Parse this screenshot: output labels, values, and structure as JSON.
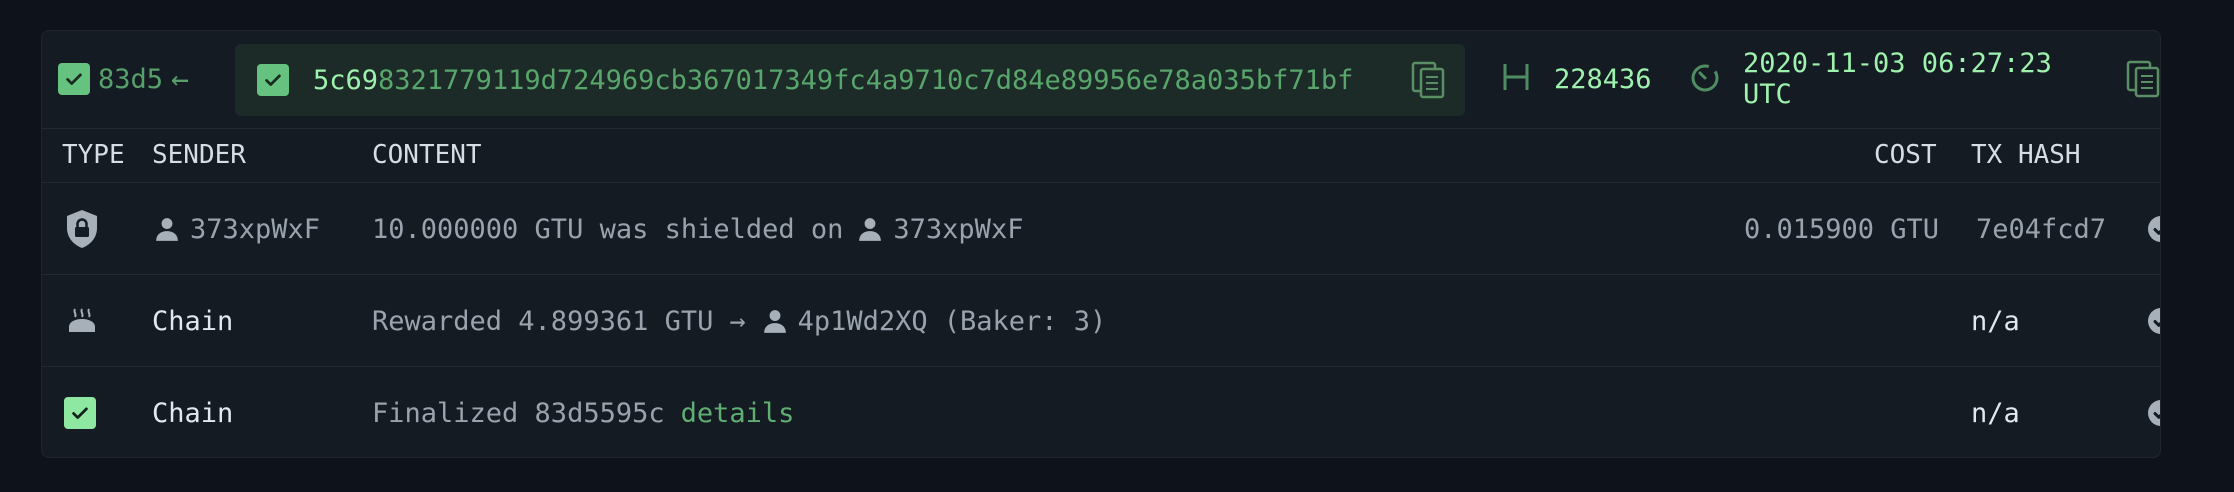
{
  "block": {
    "parent_hash": "83d5",
    "parent_arrow": "←",
    "hash_highlight": "5c69",
    "hash_rest": "8321779119d724969cb367017349fc4a9710c7d84e89956e78a035bf71bf",
    "height": "228436",
    "timestamp": "2020-11-03 06:27:23 UTC"
  },
  "table": {
    "headers": {
      "type": "TYPE",
      "sender": "SENDER",
      "content": "CONTENT",
      "cost": "COST",
      "tx_hash": "TX HASH"
    },
    "rows": [
      {
        "type_icon": "shield-lock-icon",
        "sender": "373xpWxF",
        "content_text": "10.000000 GTU was shielded on",
        "content_account": "373xpWxF",
        "cost": "0.015900 GTU",
        "tx_hash": "7e04fcd7"
      },
      {
        "type_icon": "bread-icon",
        "sender": "Chain",
        "content_text": "Rewarded 4.899361 GTU",
        "content_arrow": "→",
        "content_account": "4p1Wd2XQ",
        "content_suffix": "(Baker: 3)",
        "cost": "",
        "tx_hash": "n/a"
      },
      {
        "type_icon": "check-square-icon",
        "sender": "Chain",
        "content_text": "Finalized 83d5595c",
        "content_link": "details",
        "cost": "",
        "tx_hash": "n/a"
      }
    ]
  },
  "colors": {
    "background": "#0e131b",
    "panel": "#151b23",
    "accent": "#66c27f",
    "hash_box": "#1c2b27"
  }
}
